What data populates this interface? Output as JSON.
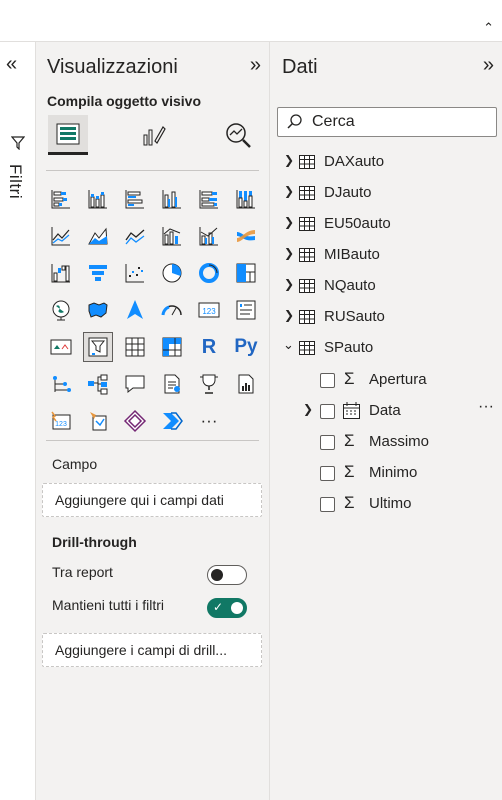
{
  "filters": {
    "label": "Filtri"
  },
  "viz": {
    "title": "Visualizzazioni",
    "subtitle": "Compila oggetto visivo",
    "campo_label": "Campo",
    "campo_placeholder": "Aggiungere qui i campi dati",
    "drill_title": "Drill-through",
    "tra_report_label": "Tra report",
    "tra_report_on": false,
    "mantieni_label": "Mantieni tutti i filtri",
    "mantieni_on": true,
    "drill_placeholder": "Aggiungere i campi di drill...",
    "more_glyph": "···",
    "r_glyph": "R",
    "py_glyph": "Py"
  },
  "data": {
    "title": "Dati",
    "search_placeholder": "Cerca",
    "tables": [
      "DAXauto",
      "DJauto",
      "EU50auto",
      "MIBauto",
      "NQauto",
      "RUSauto",
      "SPauto"
    ],
    "sp_fields": [
      "Apertura",
      "Data",
      "Massimo",
      "Minimo",
      "Ultimo"
    ],
    "more_glyph": "···"
  },
  "colors": {
    "accent": "#117865",
    "blue": "#118dff",
    "icon": "#252423"
  }
}
